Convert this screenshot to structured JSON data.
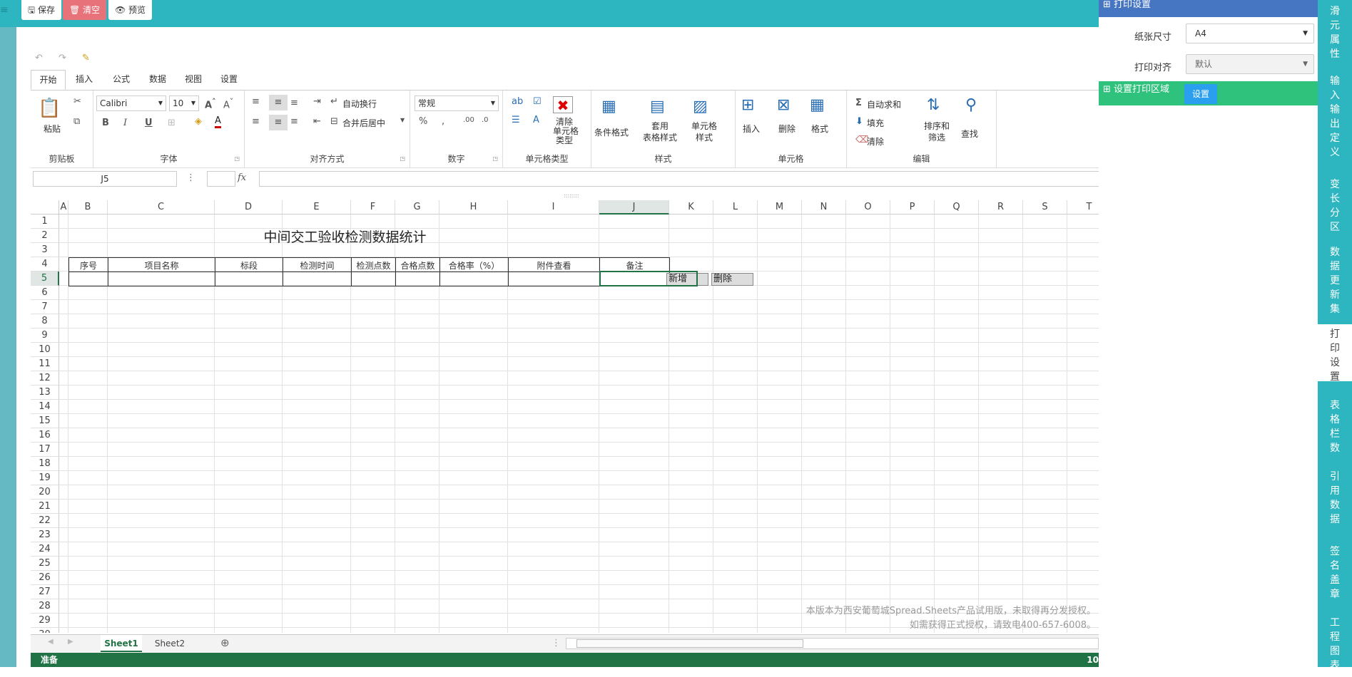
{
  "toolbar": {
    "save": "🖫 保存",
    "clear": "🗑 清空",
    "preview": "👁 预览"
  },
  "ribbon": {
    "tabs": [
      "开始",
      "插入",
      "公式",
      "数据",
      "视图",
      "设置"
    ],
    "groups": {
      "clipboard": "剪贴板",
      "font": "字体",
      "align": "对齐方式",
      "number": "数字",
      "celltype": "单元格类型",
      "style": "样式",
      "cells": "单元格",
      "edit": "编辑"
    },
    "paste": "粘贴",
    "font_name": "Calibri",
    "font_size": "10",
    "wrap": "自动换行",
    "merge": "合并后居中",
    "num_format": "常规",
    "clear_celltype": [
      "清除",
      "单元格",
      "类型"
    ],
    "cond_format": "条件格式",
    "table_style": [
      "套用",
      "表格样式"
    ],
    "cell_style": [
      "单元格",
      "样式"
    ],
    "insert": "插入",
    "delete": "删除",
    "format": "格式",
    "autosum": "自动求和",
    "fill": "填充",
    "clear": "清除",
    "sort": [
      "排序和",
      "筛选"
    ],
    "find": "查找"
  },
  "formula": {
    "namebox": "J5",
    "fx": "fx"
  },
  "columns": [
    "A",
    "B",
    "C",
    "D",
    "E",
    "F",
    "G",
    "H",
    "I",
    "J",
    "K",
    "L",
    "M",
    "N",
    "O",
    "P",
    "Q",
    "R",
    "S",
    "T"
  ],
  "rows": [
    "1",
    "2",
    "3",
    "4",
    "5",
    "6",
    "7",
    "8",
    "9",
    "10",
    "11",
    "12",
    "13",
    "14",
    "15",
    "16",
    "17",
    "18",
    "19",
    "20",
    "21",
    "22",
    "23",
    "24",
    "25",
    "26",
    "27",
    "28",
    "29",
    "30"
  ],
  "sheet": {
    "title": "中间交工验收检测数据统计",
    "headers": [
      "序号",
      "项目名称",
      "标段",
      "检测时间",
      "检测点数",
      "合格点数",
      "合格率（%）",
      "附件查看",
      "备注"
    ],
    "add_btn": "新增",
    "del_btn": "删除"
  },
  "watermark": [
    "本版本为西安葡萄城Spread.Sheets产品试用版，未取得再分发授权。",
    "如需获得正式授权，请致电400-657-6008。"
  ],
  "sheet_tabs": [
    "Sheet1",
    "Sheet2"
  ],
  "status": "准备",
  "status_right": "10",
  "panel": {
    "print_settings": "打印设置",
    "paper_size_label": "纸张尺寸",
    "paper_size": "A4",
    "align_label": "打印对齐",
    "align": "默认",
    "print_area": "设置打印区域",
    "set_btn": "设置"
  },
  "nav": [
    "滑元属性",
    "输入输出定义",
    "变长分区",
    "数据更新集",
    "打印设置",
    "表格栏数",
    "引用数据",
    "签名盖章",
    "工程图表"
  ]
}
